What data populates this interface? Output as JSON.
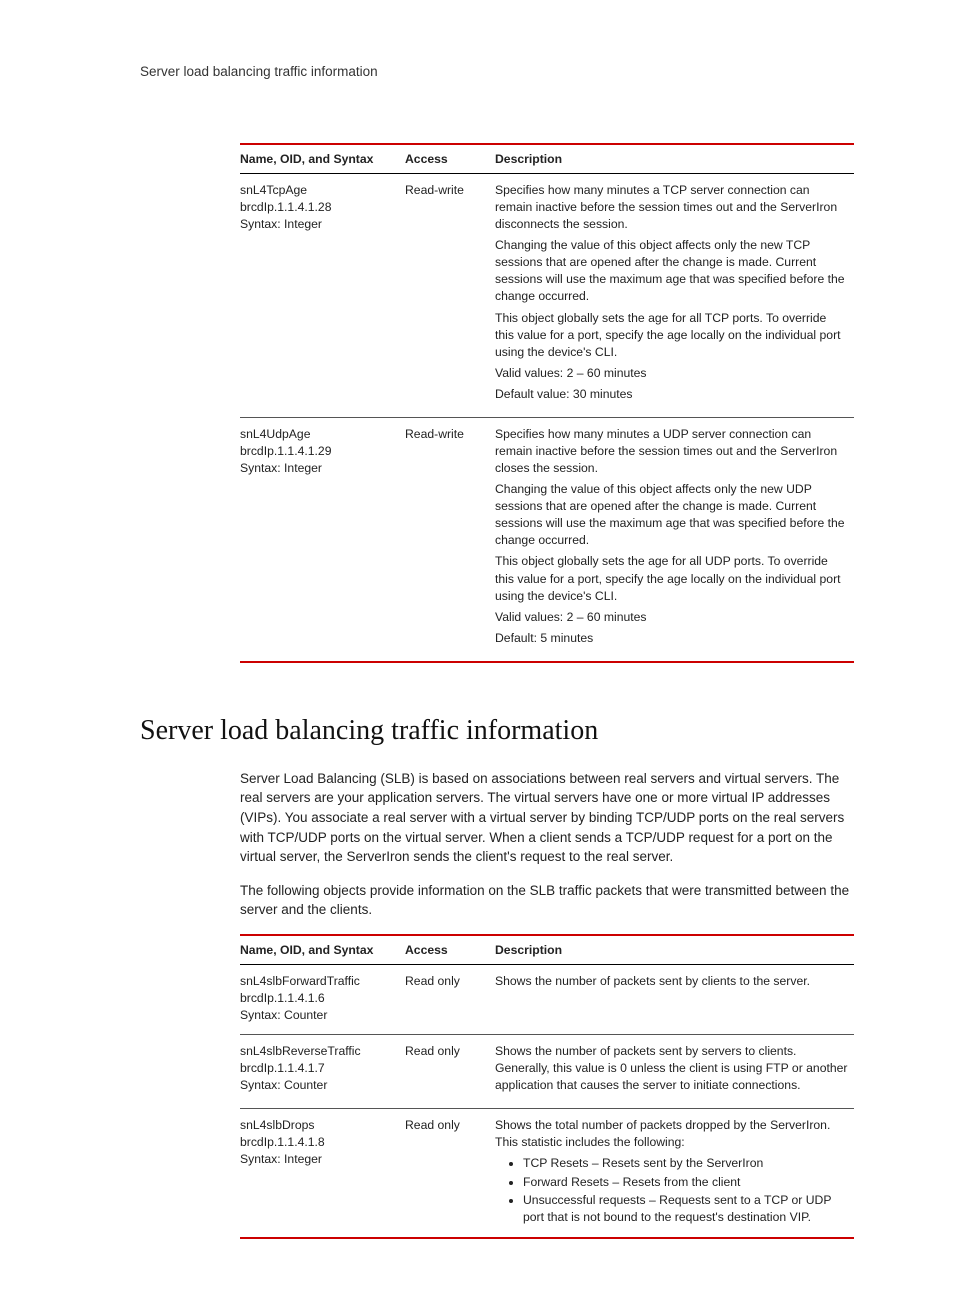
{
  "page_header": "Server load balancing traffic information",
  "section_heading": "Server load balancing traffic information",
  "table_headers": {
    "name": "Name, OID, and Syntax",
    "access": "Access",
    "description": "Description"
  },
  "intro1": "Server Load Balancing (SLB) is based on associations between real servers and virtual servers. The real servers are your application servers. The virtual servers have one or more virtual IP addresses (VIPs). You associate a real server with a virtual server by binding TCP/UDP ports on the real servers with TCP/UDP ports on the virtual server. When a client sends a TCP/UDP request for a port on the virtual server, the ServerIron sends the client's request to the real server.",
  "intro2": "The following objects provide information on the SLB traffic packets that were transmitted between the server and the clients.",
  "t1": {
    "rows": [
      {
        "name": "snL4TcpAge",
        "oid": "brcdIp.1.1.4.1.28",
        "syntax": "Syntax: Integer",
        "access": "Read-write",
        "desc": [
          "Specifies how many minutes a TCP server connection can remain inactive before the session times out and the ServerIron disconnects the session.",
          "Changing the value of this object affects only the new TCP sessions that are opened after the change is made. Current sessions will use the maximum age that was specified before the change occurred.",
          "This object globally sets the age for all TCP ports. To override this value for a port, specify the age locally on the individual port using the device's CLI.",
          "Valid values: 2 – 60 minutes",
          "Default value: 30 minutes"
        ]
      },
      {
        "name": "snL4UdpAge",
        "oid": "brcdIp.1.1.4.1.29",
        "syntax": "Syntax: Integer",
        "access": "Read-write",
        "desc": [
          "Specifies how many minutes a UDP server connection can remain inactive before the session times out and the ServerIron closes the session.",
          "Changing the value of this object affects only the new UDP sessions that are opened after the change is made. Current sessions will use the maximum age that was specified before the change occurred.",
          "This object globally sets the age for all UDP ports. To override this value for a port, specify the age locally on the individual port using the device's CLI.",
          "Valid values: 2 – 60 minutes",
          "Default: 5 minutes"
        ]
      }
    ]
  },
  "t2": {
    "rows": [
      {
        "name": "snL4slbForwardTraffic",
        "oid": "brcdIp.1.1.4.1.6",
        "syntax": "Syntax: Counter",
        "access": "Read only",
        "desc": [
          "Shows the number of packets sent by clients to the server."
        ]
      },
      {
        "name": "snL4slbReverseTraffic",
        "oid": "brcdIp.1.1.4.1.7",
        "syntax": "Syntax: Counter",
        "access": "Read only",
        "desc": [
          "Shows the number of packets sent by servers to clients. Generally, this value is 0 unless the client is using FTP or another application that causes the server to initiate connections."
        ]
      },
      {
        "name": "snL4slbDrops",
        "oid": "brcdIp.1.1.4.1.8",
        "syntax": "Syntax: Integer",
        "access": "Read only",
        "desc": [
          "Shows the total number of packets dropped by the ServerIron. This statistic includes the following:"
        ],
        "bullets": [
          "TCP Resets – Resets sent by the ServerIron",
          "Forward Resets – Resets from the client",
          "Unsuccessful requests – Requests sent to a TCP or UDP port that is not bound to the request's destination VIP."
        ]
      }
    ]
  }
}
